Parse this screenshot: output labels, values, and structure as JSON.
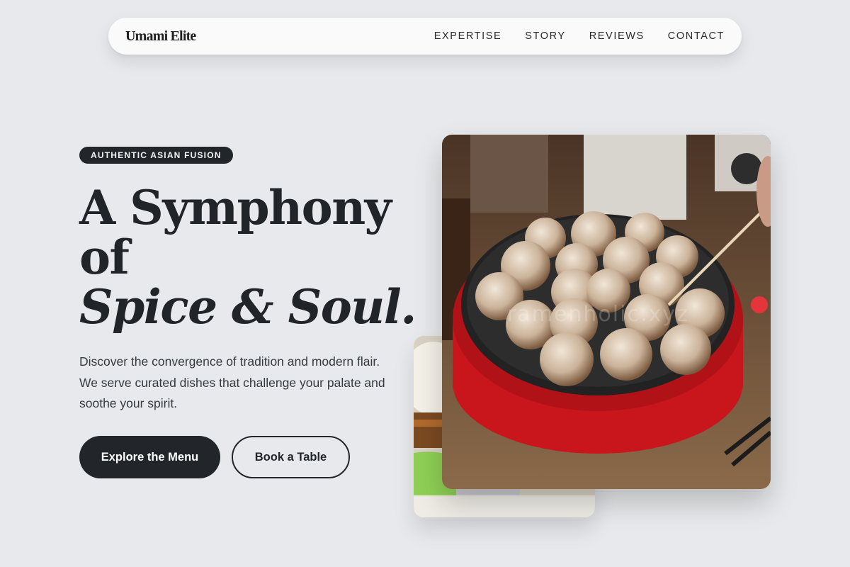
{
  "brand": {
    "logo": "Umami Elite"
  },
  "nav": {
    "links": [
      "EXPERTISE",
      "STORY",
      "REVIEWS",
      "CONTACT"
    ]
  },
  "hero": {
    "badge": "AUTHENTIC ASIAN FUSION",
    "headline_line1": "A Symphony",
    "headline_line2": "of",
    "headline_italic": "Spice & Soul.",
    "lead": "Discover the convergence of tradition and modern flair. We serve curated dishes that challenge your palate and soothe your spirit.",
    "primary_cta": "Explore the Menu",
    "secondary_cta": "Book a Table"
  },
  "images": {
    "main_alt": "Takoyaki balls cooking in a red electric pan",
    "main_watermark": "ramenholic.xyz",
    "secondary_alt": "Burger with lettuce"
  },
  "colors": {
    "background": "#e8e9ec",
    "dark": "#22262a",
    "pan_red": "#c8161c"
  }
}
